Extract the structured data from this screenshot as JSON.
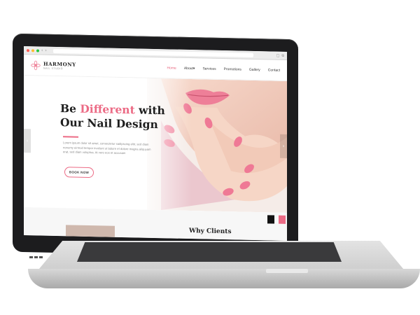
{
  "browser": {
    "traffic_lights": [
      "#ff5f56",
      "#ffbd2e",
      "#27c93f"
    ]
  },
  "site": {
    "logo": {
      "name": "HARMONY",
      "subtitle": "NAIL STUDIO",
      "icon": "flower-icon"
    },
    "menu": [
      {
        "label": "Home",
        "active": true
      },
      {
        "label": "About",
        "has_dropdown": true
      },
      {
        "label": "Services"
      },
      {
        "label": "Promotions"
      },
      {
        "label": "Gallery"
      },
      {
        "label": "Contact"
      }
    ],
    "hero": {
      "headline_line1_pre": "Be ",
      "headline_line1_accent": "Different",
      "headline_line1_post": " with",
      "headline_line2": "Our Nail Design",
      "body": "Lorem ipsum dolor sit amet, consectetur sadipscing elitr, sed diam nonumy eirmod tempor invidunt ut labore et dolore magna aliquyam erat, sed diam voluptua. At vero eos et accusam",
      "cta_label": "BOOK NOW"
    },
    "below_section": {
      "title_partial": "Why Clients"
    },
    "colors": {
      "accent": "#ec6b85",
      "text_dark": "#1e1e1e",
      "text_muted": "#8a8a8a"
    }
  }
}
